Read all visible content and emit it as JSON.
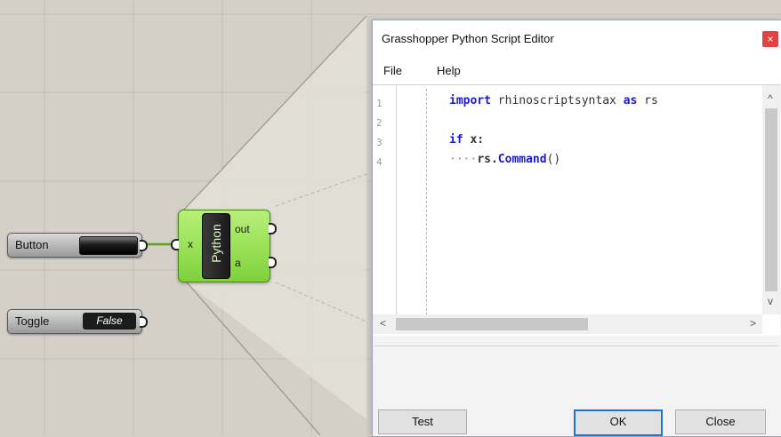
{
  "canvas": {
    "button_component": {
      "label": "Button"
    },
    "toggle_component": {
      "label": "Toggle",
      "value": "False"
    },
    "python_component": {
      "name": "Python",
      "input": "x",
      "outputs": [
        "out",
        "a"
      ]
    }
  },
  "editor_window": {
    "title": "Grasshopper Python Script Editor",
    "close_glyph": "×",
    "menu": [
      "File",
      "Help"
    ],
    "code_lines": [
      {
        "num": "1",
        "code": "import rhinoscriptsyntax as rs"
      },
      {
        "num": "2",
        "code": ""
      },
      {
        "num": "3",
        "code": "if x:"
      },
      {
        "num": "4",
        "code": "    rs.Command()"
      }
    ],
    "scroll": {
      "up": "^",
      "down": "v",
      "left": "<",
      "right": ">"
    },
    "buttons": {
      "test": "Test",
      "ok": "OK",
      "close": "Close"
    }
  }
}
